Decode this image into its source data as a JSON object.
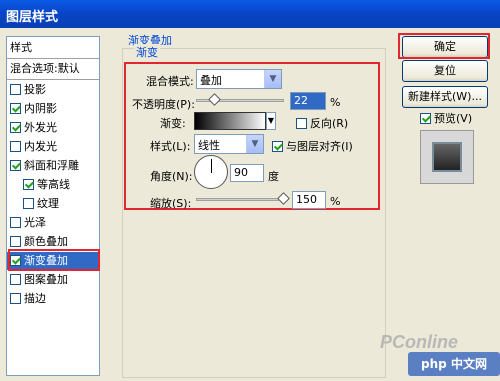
{
  "window": {
    "title": "图层样式"
  },
  "style_list": {
    "header": "样式",
    "blend_label": "混合选项:默认",
    "items": [
      {
        "label": "投影",
        "checked": false
      },
      {
        "label": "内阴影",
        "checked": true
      },
      {
        "label": "外发光",
        "checked": true
      },
      {
        "label": "内发光",
        "checked": false
      },
      {
        "label": "斜面和浮雕",
        "checked": true
      },
      {
        "label": "等高线",
        "checked": true
      },
      {
        "label": "纹理",
        "checked": false
      },
      {
        "label": "光泽",
        "checked": false
      },
      {
        "label": "颜色叠加",
        "checked": false
      },
      {
        "label": "渐变叠加",
        "checked": true,
        "selected": true
      },
      {
        "label": "图案叠加",
        "checked": false
      },
      {
        "label": "描边",
        "checked": false
      }
    ]
  },
  "panel": {
    "title": "渐变叠加",
    "group": "渐变",
    "blend_mode_label": "混合模式:",
    "blend_mode_value": "叠加",
    "opacity_label": "不透明度(P):",
    "opacity_value": "22",
    "opacity_unit": "%",
    "gradient_label": "渐变:",
    "reverse_label": "反向(R)",
    "reverse_checked": false,
    "style_label": "样式(L):",
    "style_value": "线性",
    "align_label": "与图层对齐(I)",
    "align_checked": true,
    "angle_label": "角度(N):",
    "angle_value": "90",
    "angle_unit": "度",
    "scale_label": "缩放(S):",
    "scale_value": "150",
    "scale_unit": "%"
  },
  "buttons": {
    "ok": "确定",
    "reset": "复位",
    "new_style": "新建样式(W)...",
    "preview": "预览(V)"
  },
  "watermark": {
    "text": "PConline",
    "badge": "php 中文网"
  },
  "colors": {
    "accent_red": "#e2262f",
    "selection": "#316ac5",
    "title_blue": "#0046d5"
  }
}
